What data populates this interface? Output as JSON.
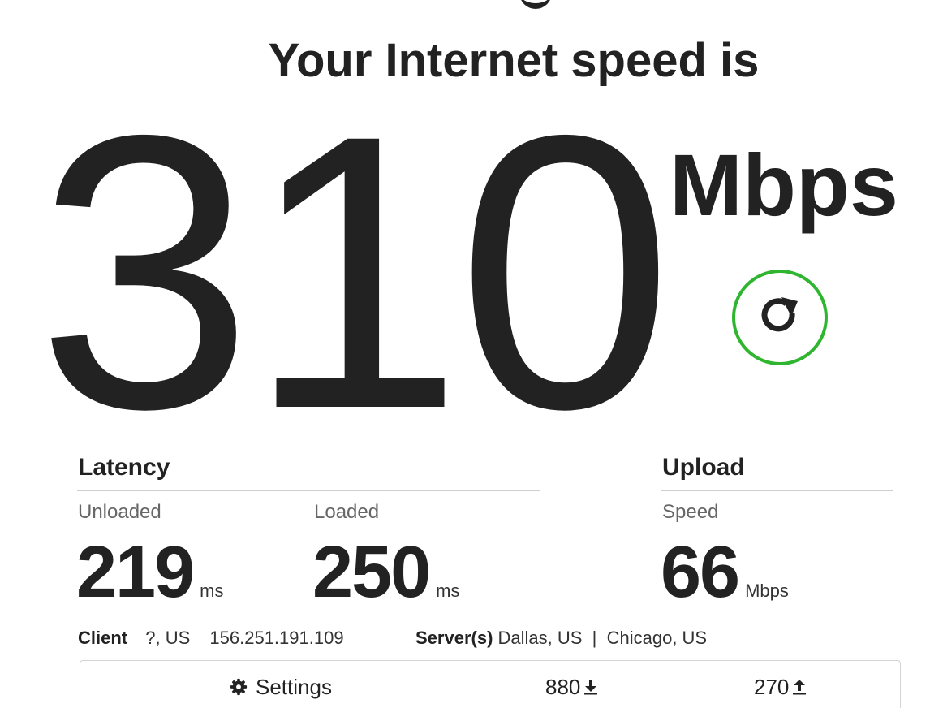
{
  "headline": "Your Internet speed is",
  "speed": {
    "value": "310",
    "units": "Mbps"
  },
  "refresh": {
    "icon": "refresh-icon",
    "accent_color": "#2fb52f"
  },
  "latency": {
    "title": "Latency",
    "unloaded": {
      "label": "Unloaded",
      "value": "219",
      "unit": "ms"
    },
    "loaded": {
      "label": "Loaded",
      "value": "250",
      "unit": "ms"
    }
  },
  "upload": {
    "title": "Upload",
    "speed": {
      "label": "Speed",
      "value": "66",
      "unit": "Mbps"
    }
  },
  "client": {
    "label": "Client",
    "location": "?, US",
    "ip": "156.251.191.109"
  },
  "servers": {
    "label": "Server(s)",
    "list": "Dallas, US  |  Chicago, US"
  },
  "footer": {
    "settings_label": "Settings",
    "settings_icon": "gear-icon",
    "download_count": "880",
    "download_icon": "download-arrow-icon",
    "upload_count": "270",
    "upload_icon": "upload-arrow-icon"
  }
}
